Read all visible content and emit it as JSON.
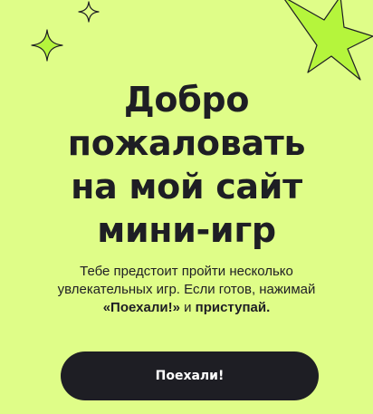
{
  "hero": {
    "title_lines": [
      "Добро",
      "пожаловать",
      "на мой сайт",
      "мини-игр"
    ],
    "description": {
      "line1": "Тебе предстоит пройти несколько",
      "line2": "увлекательных игр. Если готов, нажимай",
      "emph1": "«Поехали!»",
      "connector": " и ",
      "emph2": "приступай."
    },
    "cta_label": "Поехали!"
  },
  "colors": {
    "background": "#DFFD88",
    "accent_star": "#B5F53C",
    "text": "#1E1E24",
    "button_bg": "#1E1E24",
    "button_text": "#FFFFFF"
  },
  "icons": [
    "sparkle-outline-icon",
    "sparkle-filled-icon",
    "star-burst-icon"
  ]
}
